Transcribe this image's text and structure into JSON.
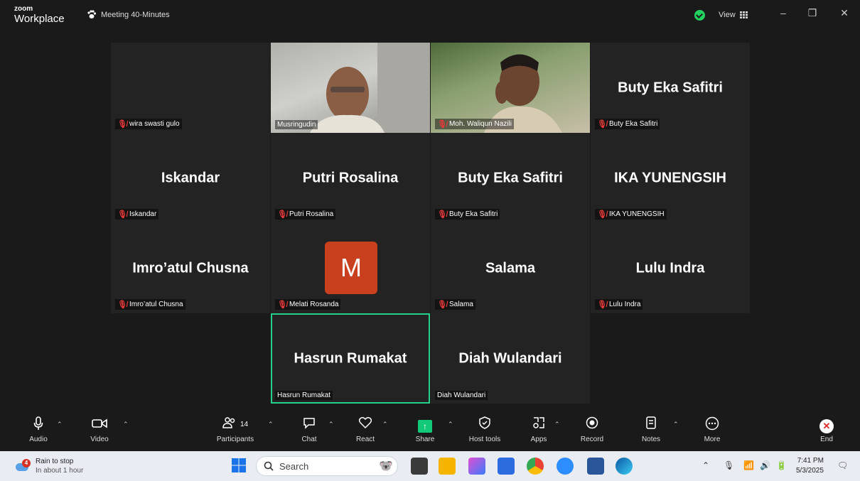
{
  "titlebar": {
    "logo_top": "zoom",
    "logo_bottom": "Workplace",
    "meeting_title": "Meeting 40-Minutes",
    "view_label": "View",
    "minimize": "–",
    "restore": "❐",
    "close": "✕"
  },
  "tiles": [
    {
      "name": "",
      "label": "wira swasti gulo",
      "muted": true
    },
    {
      "name": "",
      "label": "Musringudin",
      "muted": false,
      "video": true
    },
    {
      "name": "",
      "label": "Moh. Waliqun Nazili",
      "muted": true,
      "video": true
    },
    {
      "name": "Buty Eka Safitri",
      "label": "Buty Eka Safitri",
      "muted": true
    },
    {
      "name": "Iskandar",
      "label": "Iskandar",
      "muted": true
    },
    {
      "name": "Putri Rosalina",
      "label": "Putri Rosalina",
      "muted": true
    },
    {
      "name": "Buty Eka Safitri",
      "label": "Buty Eka Safitri",
      "muted": true
    },
    {
      "name": "IKA YUNENGSIH",
      "label": "IKA YUNENGSIH",
      "muted": true
    },
    {
      "name": "Imro’atul Chusna",
      "label": "Imro’atul Chusna",
      "muted": true
    },
    {
      "name": "",
      "avatar": "M",
      "label": "Melati Rosanda",
      "muted": true
    },
    {
      "name": "Salama",
      "label": "Salama",
      "muted": true
    },
    {
      "name": "Lulu Indra",
      "label": "Lulu Indra",
      "muted": true
    },
    {
      "name": "Hasrun Rumakat",
      "label": "Hasrun Rumakat",
      "muted": false,
      "active": true
    },
    {
      "name": "Diah Wulandari",
      "label": "Diah Wulandari",
      "muted": false
    }
  ],
  "toolbar": {
    "audio": "Audio",
    "video": "Video",
    "participants": "Participants",
    "participants_count": "14",
    "chat": "Chat",
    "react": "React",
    "share": "Share",
    "host_tools": "Host tools",
    "apps": "Apps",
    "record": "Record",
    "notes": "Notes",
    "more": "More",
    "end": "End"
  },
  "taskbar": {
    "weather_title": "Rain to stop",
    "weather_sub": "In about 1 hour",
    "weather_badge": "4",
    "search_placeholder": "Search",
    "time": "7:41 PM",
    "date": "5/3/2025"
  },
  "colors": {
    "active_border": "#23d18b",
    "avatar_bg": "#c9401e",
    "mute_red": "#e63a3a",
    "share_green": "#12c97a"
  }
}
